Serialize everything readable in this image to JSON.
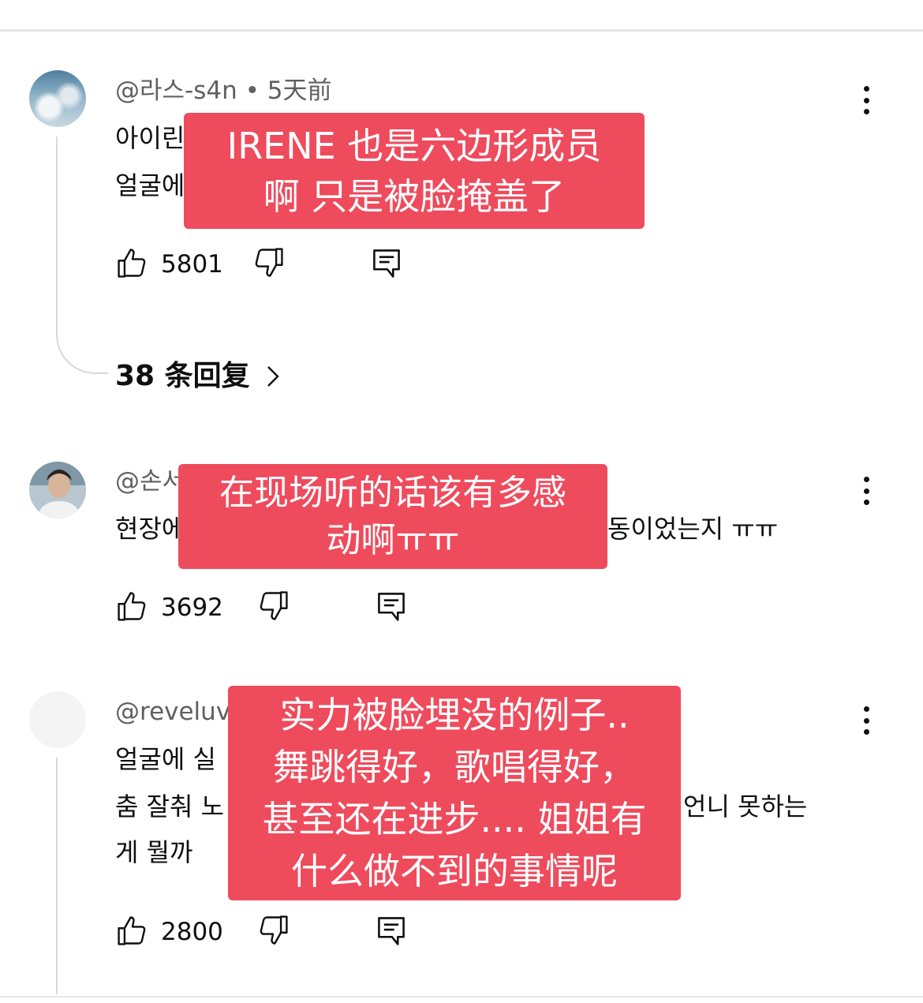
{
  "comments": [
    {
      "author": "@라스-s4n",
      "separator": " • ",
      "time": "5天前",
      "text_lines": [
        "아이린",
        "얼굴에"
      ],
      "likes": "5801",
      "overlay_lines": [
        "IRENE 也是六边形成员",
        "啊  只是被脸掩盖了"
      ],
      "replies_label": "38 条回复"
    },
    {
      "author": "@손서",
      "text_lines": [
        "현장에서 들으면 얼마나 감동이었는지 ㅠㅠ"
      ],
      "text_left": "현장에",
      "text_right": "동이었는지 ㅠㅠ",
      "likes": "3692",
      "overlay_lines": [
        "在现场听的话该有多感",
        "动啊ㅠㅠ"
      ]
    },
    {
      "author": "@reveluv",
      "text_lines": [
        "얼굴에 실",
        "춤 잘춰 노",
        "게 뭘까"
      ],
      "text_line2_right": "언니 못하는",
      "likes": "2800",
      "overlay_lines": [
        "实力被脸埋没的例子..",
        "舞跳得好，歌唱得好，",
        "甚至还在进步.... 姐姐有",
        "什么做不到的事情呢"
      ]
    }
  ],
  "icons": {
    "like": "thumbs-up-icon",
    "dislike": "thumbs-down-icon",
    "reply": "reply-comment-icon",
    "more": "more-vertical-icon",
    "chevron": "chevron-right-icon"
  },
  "colors": {
    "overlay_bg": "#ee4b5d",
    "overlay_text": "#ffffff",
    "meta_text": "#606060",
    "body_text": "#0f0f0f"
  }
}
